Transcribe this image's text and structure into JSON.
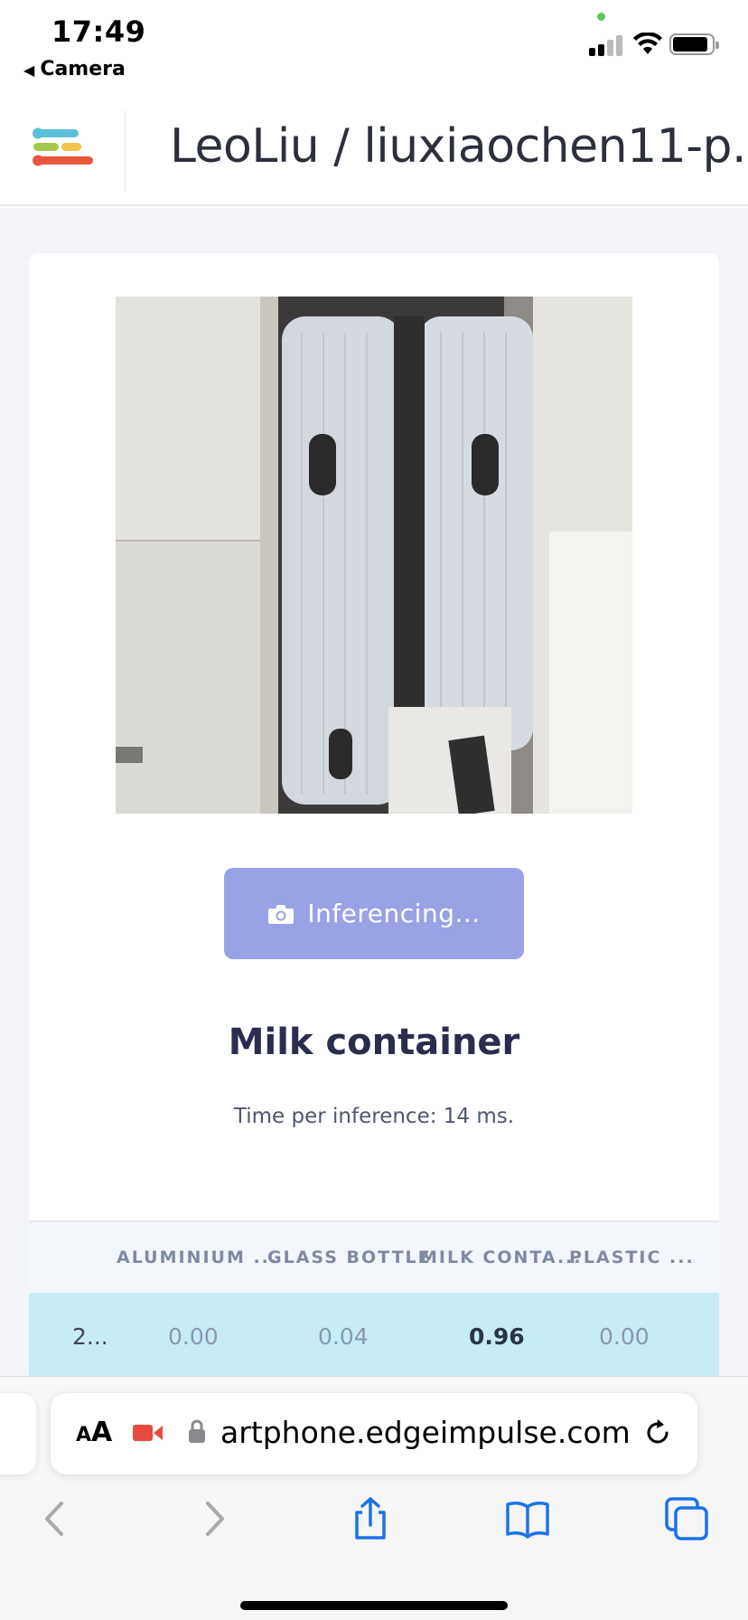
{
  "status_bar": {
    "time": "17:49",
    "back_app": "Camera"
  },
  "header": {
    "project_title": "LeoLiu / liuxiaochen11-p..."
  },
  "main": {
    "button_label": "Inferencing...",
    "result_label": "Milk container",
    "time_per_inference": "Time per inference: 14 ms."
  },
  "table": {
    "columns": [
      "ALUMINIUM ...",
      "GLASS BOTTLE",
      "MILK CONTA...",
      "PLASTIC ..."
    ],
    "row": {
      "timestamp": "2...",
      "values": [
        "0.00",
        "0.04",
        "0.96",
        "0.00"
      ],
      "top_index": 2
    }
  },
  "safari": {
    "text_size": "AA",
    "url": "artphone.edgeimpulse.com"
  },
  "colors": {
    "accent_button": "#9aa2e6",
    "row_highlight": "#c6edf6",
    "ios_blue": "#1a73e8",
    "record_red": "#e84a3c"
  },
  "icons": {
    "menu": "edge-impulse-logo-icon",
    "camera": "camera-icon",
    "lock": "lock-icon",
    "reload": "reload-icon",
    "record": "screen-record-icon",
    "back": "chevron-left-icon",
    "forward": "chevron-right-icon",
    "share": "share-icon",
    "bookmarks": "book-icon",
    "tabs": "tabs-icon"
  }
}
